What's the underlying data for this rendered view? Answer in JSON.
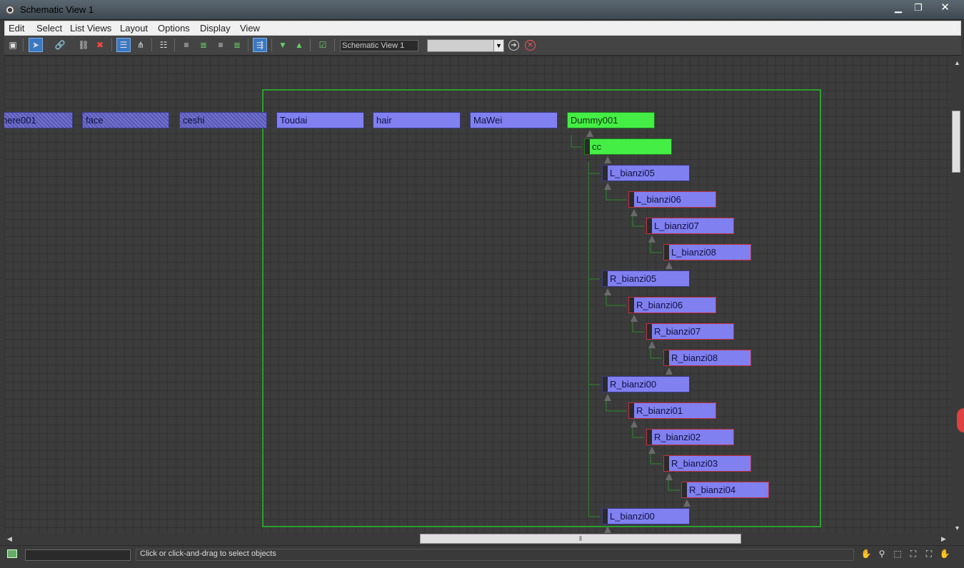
{
  "window": {
    "title": "Schematic View 1",
    "controls": {
      "minimize": "▁",
      "maximize": "❐",
      "close": "✕"
    }
  },
  "menu": [
    "Edit",
    "Select",
    "List Views",
    "Layout",
    "Options",
    "Display",
    "View"
  ],
  "toolbar": {
    "view_name": "Schematic View 1",
    "view_select_value": "",
    "icons": [
      "display-floater-icon",
      "select-icon",
      "connect-icon",
      "unlink-icon",
      "delete-icon",
      "hierarchy-mode-icon",
      "references-mode-icon",
      "always-arrange-icon",
      "align-left-icon",
      "align-center-icon",
      "align-right-icon",
      "align-bottom-icon",
      "move-children-icon",
      "expand-icon",
      "collapse-icon",
      "preferences-icon",
      "go-icon",
      "cancel-icon"
    ]
  },
  "nodes": {
    "here001": "here001",
    "face": "face",
    "ceshi": "ceshi",
    "toudai": "Toudai",
    "hair": "hair",
    "mawei": "MaWei",
    "dummy001": "Dummy001",
    "cc": "cc",
    "l_bianzi05": "L_bianzi05",
    "l_bianzi06": "L_bianzi06",
    "l_bianzi07": "L_bianzi07",
    "l_bianzi08": "L_bianzi08",
    "r_bianzi05": "R_bianzi05",
    "r_bianzi06": "R_bianzi06",
    "r_bianzi07": "R_bianzi07",
    "r_bianzi08": "R_bianzi08",
    "r_bianzi00": "R_bianzi00",
    "r_bianzi01": "R_bianzi01",
    "r_bianzi02": "R_bianzi02",
    "r_bianzi03": "R_bianzi03",
    "r_bianzi04": "R_bianzi04",
    "l_bianzi00": "L_bianzi00"
  },
  "colors": {
    "node": "#8080f0",
    "selected": "#44ee44",
    "group": "#2ea02e",
    "link": "#2a8a2a"
  },
  "status": {
    "text": "Click or click-and-drag to select objects"
  }
}
